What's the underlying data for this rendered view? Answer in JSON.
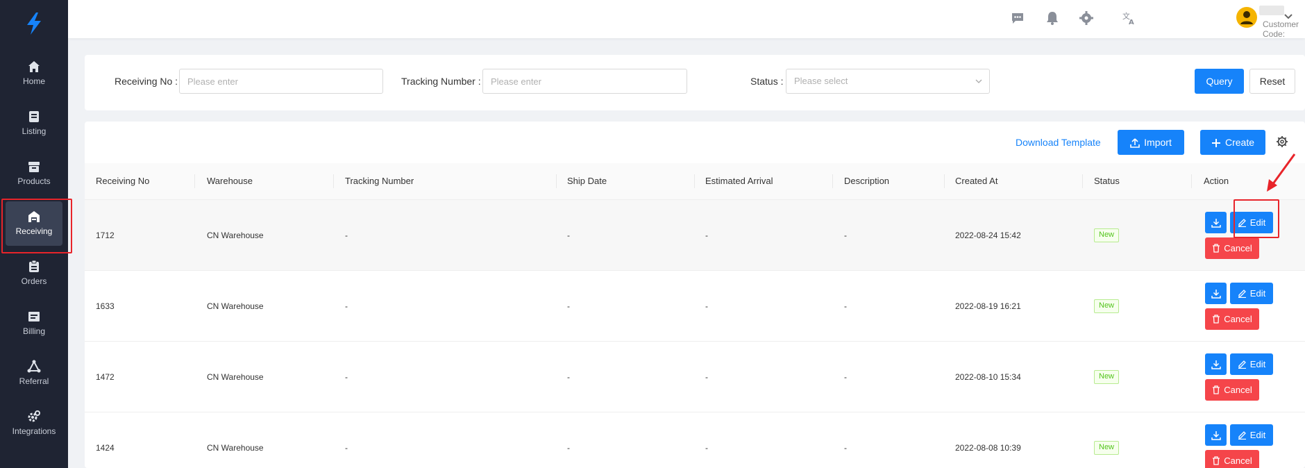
{
  "sidebar": {
    "items": [
      {
        "label": "Home",
        "icon": "home-icon"
      },
      {
        "label": "Listing",
        "icon": "listing-icon"
      },
      {
        "label": "Products",
        "icon": "products-icon"
      },
      {
        "label": "Receiving",
        "icon": "receiving-icon",
        "active": true
      },
      {
        "label": "Orders",
        "icon": "orders-icon"
      },
      {
        "label": "Billing",
        "icon": "billing-icon"
      },
      {
        "label": "Referral",
        "icon": "referral-icon"
      },
      {
        "label": "Integrations",
        "icon": "integrations-icon"
      }
    ]
  },
  "header": {
    "customer_code_label": "Customer Code:"
  },
  "search": {
    "receiving_no_label": "Receiving No :",
    "receiving_no_placeholder": "Please enter",
    "tracking_number_label": "Tracking Number :",
    "tracking_number_placeholder": "Please enter",
    "status_label": "Status :",
    "status_placeholder": "Please select",
    "query_label": "Query",
    "reset_label": "Reset"
  },
  "toolbar": {
    "download_template": "Download Template",
    "import_label": "Import",
    "create_label": "Create"
  },
  "table": {
    "columns": [
      "Receiving No",
      "Warehouse",
      "Tracking Number",
      "Ship Date",
      "Estimated Arrival",
      "Description",
      "Created At",
      "Status",
      "Action"
    ],
    "rows": [
      {
        "receiving_no": "1712",
        "warehouse": "CN Warehouse",
        "tracking_number": "-",
        "ship_date": "-",
        "estimated_arrival": "-",
        "description": "-",
        "created_at": "2022-08-24 15:42",
        "status": "New"
      },
      {
        "receiving_no": "1633",
        "warehouse": "CN Warehouse",
        "tracking_number": "-",
        "ship_date": "-",
        "estimated_arrival": "-",
        "description": "-",
        "created_at": "2022-08-19 16:21",
        "status": "New"
      },
      {
        "receiving_no": "1472",
        "warehouse": "CN Warehouse",
        "tracking_number": "-",
        "ship_date": "-",
        "estimated_arrival": "-",
        "description": "-",
        "created_at": "2022-08-10 15:34",
        "status": "New"
      },
      {
        "receiving_no": "1424",
        "warehouse": "CN Warehouse",
        "tracking_number": "-",
        "ship_date": "-",
        "estimated_arrival": "-",
        "description": "-",
        "created_at": "2022-08-08 10:39",
        "status": "New"
      }
    ],
    "edit_label": "Edit",
    "cancel_label": "Cancel"
  },
  "colors": {
    "primary": "#1683fa",
    "danger": "#f5454a",
    "sidebar_bg": "#1f2433",
    "annotation_red": "#e8242a",
    "status_new": "#52c41a"
  }
}
